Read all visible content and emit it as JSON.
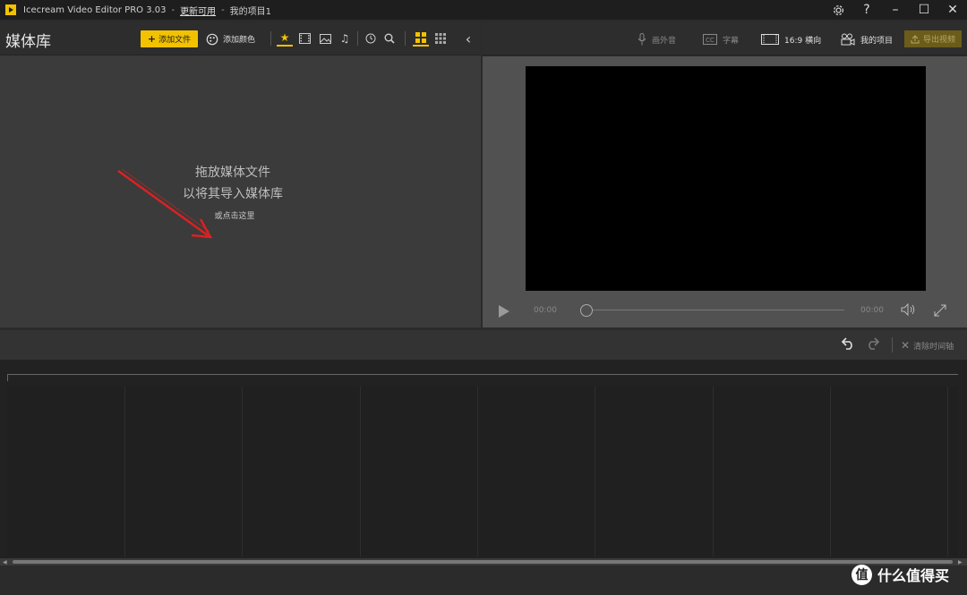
{
  "titlebar": {
    "app_name": "Icecream Video Editor PRO 3.03",
    "separator": "-",
    "update_link": "更新可用",
    "project_name": "我的项目1",
    "settings_icon": "gear-icon",
    "help_icon": "?",
    "minimize": "–",
    "maximize": "☐",
    "close": "✕"
  },
  "media_library": {
    "title": "媒体库",
    "add_file_label": "添加文件",
    "add_file_plus": "+",
    "add_color_label": "添加颜色",
    "tabs": [
      "star-icon",
      "film-icon",
      "image-icon",
      "music-icon"
    ],
    "view_modes": [
      "grid-large-icon",
      "grid-small-icon"
    ],
    "drop_text_line1": "拖放媒体文件",
    "drop_text_line2": "以将其导入媒体库",
    "click_here_link": "或点击这里"
  },
  "preview_toolbar": {
    "voiceover_label": "画外音",
    "subtitles_label": "字幕",
    "aspect_label": "16:9 横向",
    "project_label": "我的项目",
    "export_label": "导出视频"
  },
  "player": {
    "time_current": "00:00",
    "time_total": "00:00",
    "progress": 0
  },
  "timeline": {
    "clear_label": "清除时间轴"
  },
  "watermark": {
    "badge": "值",
    "text": "什么值得买"
  },
  "colors": {
    "accent": "#f2c200",
    "annotation_arrow": "#e02020"
  }
}
